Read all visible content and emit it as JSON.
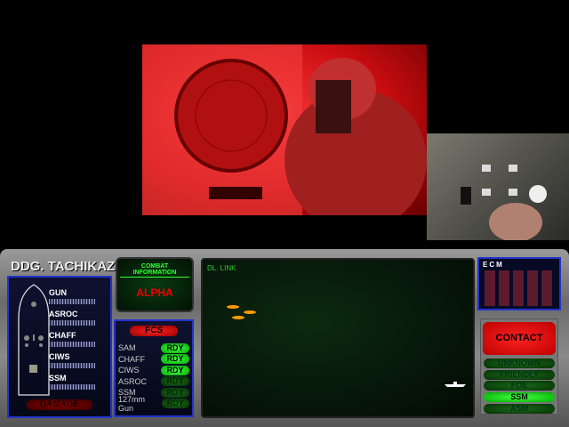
{
  "ship": {
    "title": "DDG. TACHIKAZE",
    "weapons": [
      "GUN",
      "ASROC",
      "CHAFF",
      "CIWS",
      "SSM"
    ],
    "damage_label": "DAMAGE"
  },
  "combat_info": {
    "header": "COMBAT INFORMATION",
    "value": "ALPHA"
  },
  "fcs": {
    "title": "FCS",
    "rows": [
      {
        "name": "SAM",
        "status": "RDY",
        "active": true
      },
      {
        "name": "CHAFF",
        "status": "RDY",
        "active": true
      },
      {
        "name": "CIWS",
        "status": "RDY",
        "active": true
      },
      {
        "name": "ASROC",
        "status": "RDY",
        "active": false
      },
      {
        "name": "SSM",
        "status": "RDY",
        "active": false
      },
      {
        "name": "127mm Gun",
        "status": "RDY",
        "active": false
      }
    ]
  },
  "datalink": {
    "title": "DL. LINK"
  },
  "ecm": {
    "title": "ECM"
  },
  "contact": {
    "label": "CONTACT",
    "types": [
      {
        "label": "UNKNOWN",
        "active": false
      },
      {
        "label": "FRIENDLY",
        "active": false
      },
      {
        "label": "FOE",
        "active": false
      },
      {
        "label": "SSM",
        "active": true
      },
      {
        "label": "ASM",
        "active": false
      }
    ]
  },
  "colors": {
    "accent_red": "#e00000",
    "ready_green": "#22ee22",
    "panel_blue": "#2233cc"
  }
}
